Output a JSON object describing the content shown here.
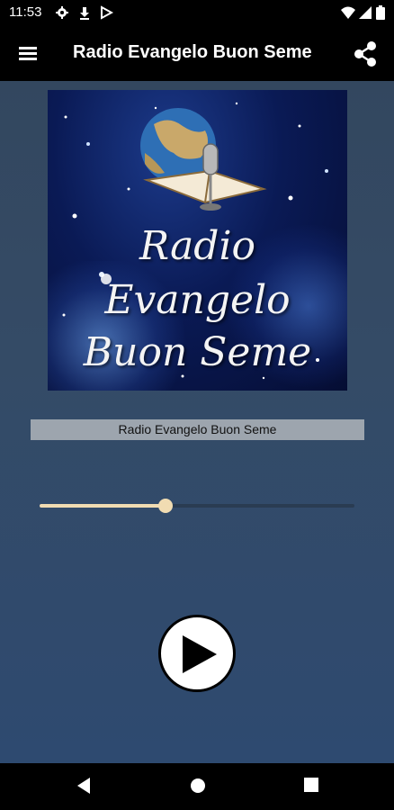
{
  "status_bar": {
    "time": "11:53",
    "icons": [
      "gear-icon",
      "download-icon",
      "play-store-icon",
      "wifi-icon",
      "signal-icon",
      "battery-icon"
    ]
  },
  "app_bar": {
    "title": "Radio Evangelo Buon Seme",
    "menu_icon": "hamburger-menu-icon",
    "share_icon": "share-icon"
  },
  "artwork": {
    "lines": [
      "Radio",
      "Evangelo",
      "Buon Seme"
    ]
  },
  "player": {
    "station_name": "Radio Evangelo Buon Seme",
    "volume_percent": 40,
    "accent_color": "#f1dcb2",
    "play_icon": "play-icon"
  },
  "nav_bar": {
    "back_icon": "back-icon",
    "home_icon": "home-icon",
    "recents_icon": "recents-icon"
  }
}
